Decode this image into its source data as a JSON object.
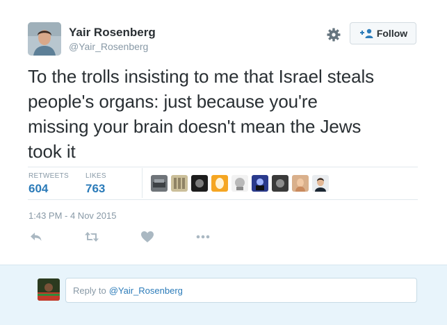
{
  "author": {
    "name": "Yair Rosenberg",
    "handle": "@Yair_Rosenberg"
  },
  "follow_label": "Follow",
  "tweet": {
    "line1": "To the trolls insisting to me that Israel steals",
    "line2": "people's organs: just because you're",
    "line3": "missing your brain doesn't mean the Jews",
    "line4": "took it"
  },
  "stats": {
    "retweets_label": "RETWEETS",
    "retweets_value": "604",
    "likes_label": "LIKES",
    "likes_value": "763"
  },
  "timestamp": "1:43 PM - 4 Nov 2015",
  "actions": [
    "reply-icon",
    "retweet-icon",
    "heart-icon",
    "more-icon"
  ],
  "reply": {
    "placeholder": "Reply to",
    "mention": "@Yair_Rosenberg"
  },
  "colors": {
    "link": "#2b7bb9",
    "muted": "#8899a6",
    "text": "#292f33",
    "reply_bg": "#e8f4fb"
  }
}
